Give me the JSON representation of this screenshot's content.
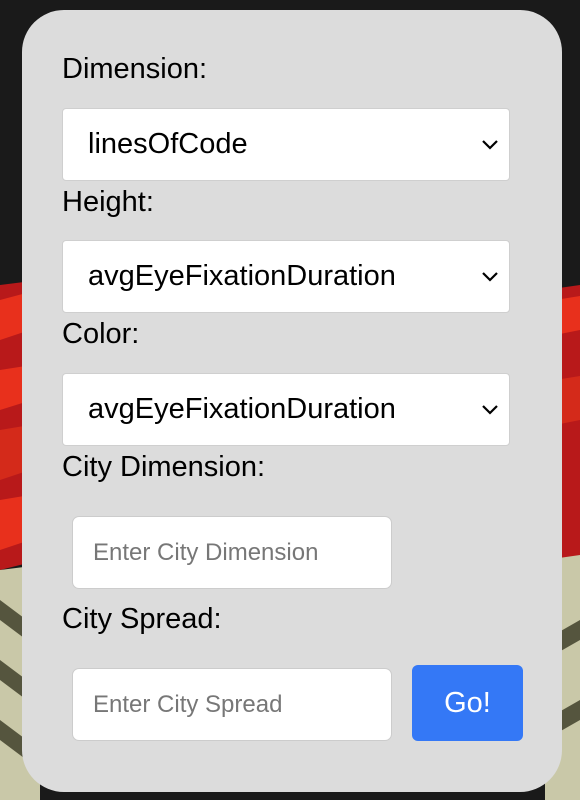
{
  "controls": {
    "dimension": {
      "label": "Dimension:",
      "selected": "linesOfCode"
    },
    "height": {
      "label": "Height:",
      "selected": "avgEyeFixationDuration"
    },
    "color": {
      "label": "Color:",
      "selected": "avgEyeFixationDuration"
    },
    "city_dimension": {
      "label": "City Dimension:",
      "placeholder": "Enter City Dimension",
      "value": ""
    },
    "city_spread": {
      "label": "City Spread:",
      "placeholder": "Enter City Spread",
      "value": ""
    },
    "go_label": "Go!"
  },
  "icons": {
    "dropdown": "chevron-down-icon"
  },
  "colors": {
    "panel_bg": "#dcdcdc",
    "go_button": "#3478f6",
    "scene_red": "#b8191a",
    "scene_bright_red": "#e8301c",
    "scene_cream": "#c9c8a8"
  }
}
